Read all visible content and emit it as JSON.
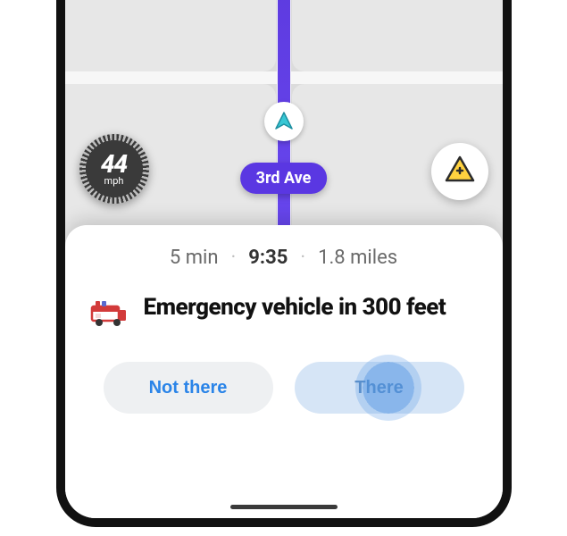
{
  "map": {
    "street_label": "3rd Ave",
    "speed": {
      "value": "44",
      "unit": "mph"
    }
  },
  "trip_summary": {
    "eta_duration": "5 min",
    "arrival_time": "9:35",
    "distance": "1.8 miles"
  },
  "alert": {
    "title": "Emergency vehicle in 300 feet",
    "icon": "emergency-vehicle-icon"
  },
  "buttons": {
    "not_there_label": "Not there",
    "there_label": "There"
  },
  "colors": {
    "route": "#5a37e2",
    "primary_text": "#111",
    "accent_blue": "#2a84e8"
  }
}
